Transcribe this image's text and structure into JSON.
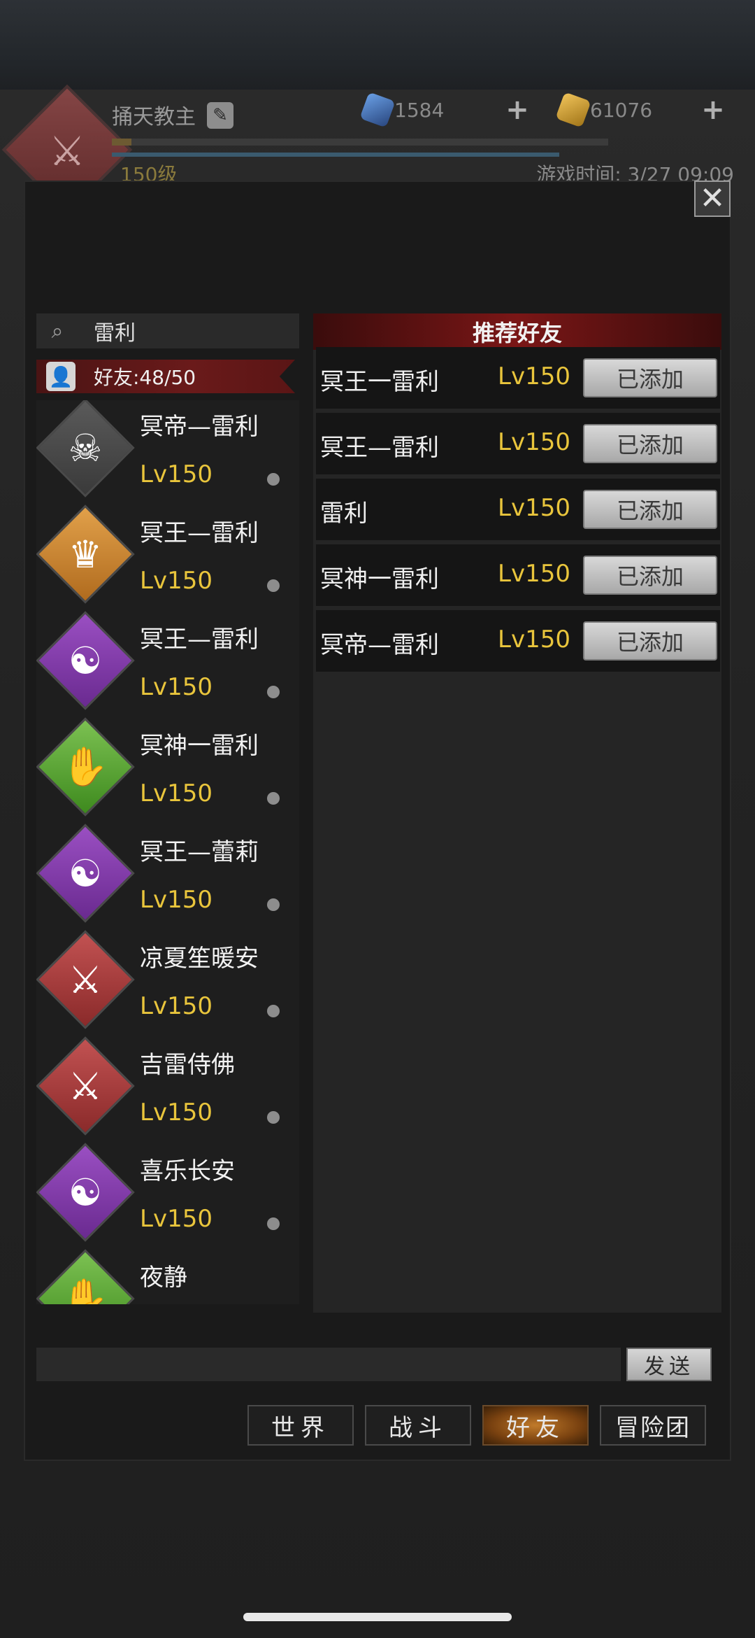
{
  "header": {
    "player_name": "捅天教主",
    "level": "150级",
    "game_time": "游戏时间: 3/27 09:09",
    "xp_progress": 0.04,
    "gems": "1584",
    "gold": "61076",
    "plus_symbol": "+"
  },
  "close_symbol": "✕",
  "search": {
    "value": "雷利"
  },
  "friend_count": "好友:48/50",
  "friends": [
    {
      "name": "冥帝—雷利",
      "level": "Lv150",
      "avatar": "skull-crown-icon",
      "color": "gray"
    },
    {
      "name": "冥王—雷利",
      "level": "Lv150",
      "avatar": "crown-icon",
      "color": "orange"
    },
    {
      "name": "冥王—雷利",
      "level": "Lv150",
      "avatar": "gourd-bagua-icon",
      "color": "purple"
    },
    {
      "name": "冥神一雷利",
      "level": "Lv150",
      "avatar": "hand-icon",
      "color": "green"
    },
    {
      "name": "冥王—蕾莉",
      "level": "Lv150",
      "avatar": "gourd-bagua-icon",
      "color": "purple"
    },
    {
      "name": "凉夏笙暖安",
      "level": "Lv150",
      "avatar": "crossed-axes-icon",
      "color": "red"
    },
    {
      "name": "吉雷侍佛",
      "level": "Lv150",
      "avatar": "crossed-axes-icon",
      "color": "red"
    },
    {
      "name": "喜乐长安",
      "level": "Lv150",
      "avatar": "gourd-bagua-icon",
      "color": "purple"
    },
    {
      "name": "夜静",
      "level": "",
      "avatar": "hand-icon",
      "color": "green"
    }
  ],
  "recommend": {
    "title": "推荐好友",
    "rows": [
      {
        "name": "冥王一雷利",
        "level": "Lv150",
        "button": "已添加"
      },
      {
        "name": "冥王—雷利",
        "level": "Lv150",
        "button": "已添加"
      },
      {
        "name": "雷利",
        "level": "Lv150",
        "button": "已添加"
      },
      {
        "name": "冥神一雷利",
        "level": "Lv150",
        "button": "已添加"
      },
      {
        "name": "冥帝—雷利",
        "level": "Lv150",
        "button": "已添加"
      }
    ]
  },
  "chat": {
    "input_value": "",
    "send_label": "发送"
  },
  "tabs": [
    {
      "label": "世界",
      "active": false
    },
    {
      "label": "战斗",
      "active": false
    },
    {
      "label": "好友",
      "active": true
    },
    {
      "label": "冒险团",
      "active": false
    }
  ]
}
